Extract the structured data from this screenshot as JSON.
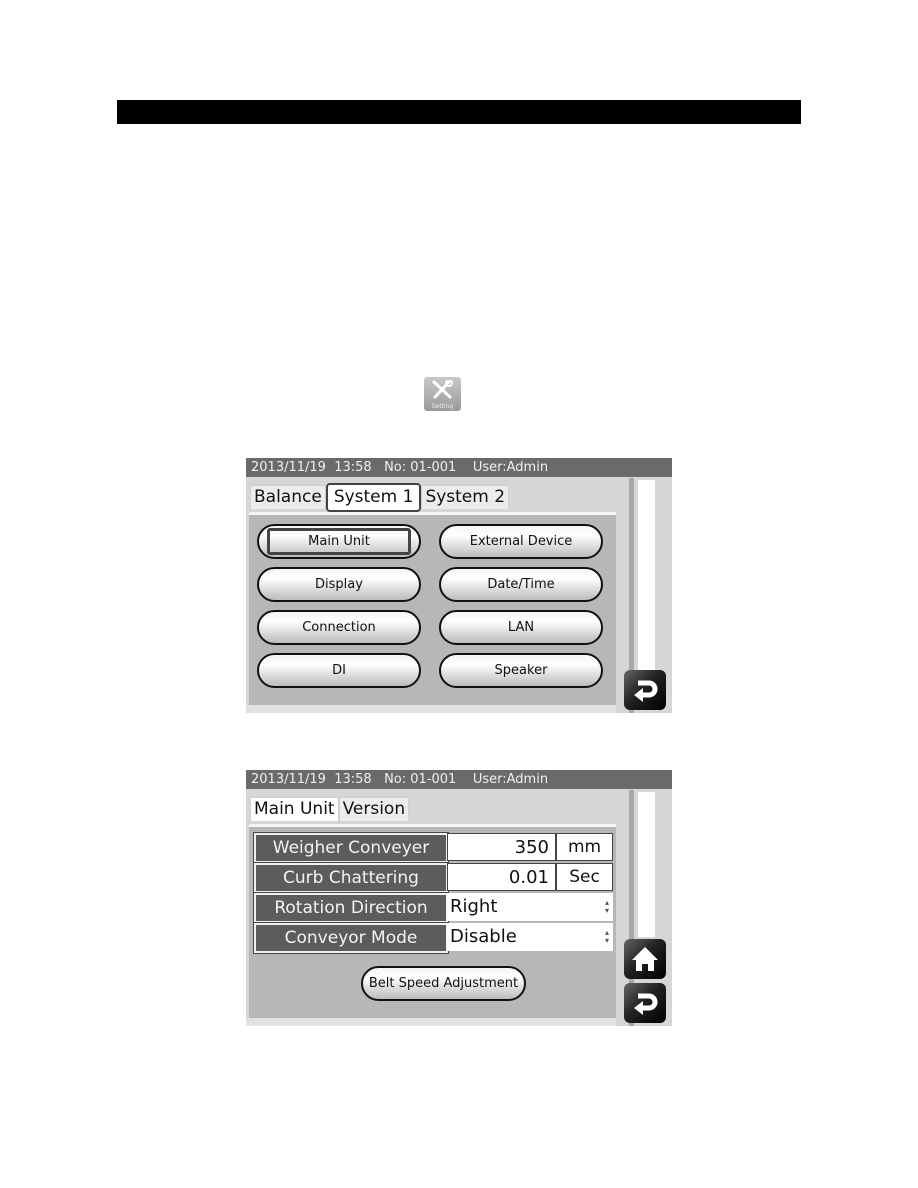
{
  "page": {
    "heading_bar_text": "",
    "inline_icon": {
      "icon": "setting-icon",
      "label": "Setting"
    }
  },
  "screen1": {
    "status": {
      "datetime": "2013/11/19  13:58",
      "number": "No: 01-001",
      "user": "User:Admin"
    },
    "tabs": [
      {
        "label": "Balance",
        "active": false
      },
      {
        "label": "System 1",
        "active": true
      },
      {
        "label": "System 2",
        "active": false
      }
    ],
    "buttons": [
      {
        "label": "Main Unit",
        "selected": true
      },
      {
        "label": "External Device"
      },
      {
        "label": "Display"
      },
      {
        "label": "Date/Time"
      },
      {
        "label": "Connection"
      },
      {
        "label": "LAN"
      },
      {
        "label": "DI"
      },
      {
        "label": "Speaker"
      }
    ],
    "nav": {
      "back_icon": "return-arrow-icon"
    }
  },
  "screen2": {
    "status": {
      "datetime": "2013/11/19  13:58",
      "number": "No: 01-001",
      "user": "User:Admin"
    },
    "tabs": [
      {
        "label": "Main Unit",
        "active": true
      },
      {
        "label": "Version",
        "active": false
      }
    ],
    "fields": [
      {
        "label": "Weigher Conveyer",
        "value": "350",
        "unit": "mm"
      },
      {
        "label": "Curb Chattering",
        "value": "0.01",
        "unit": "Sec"
      },
      {
        "label": "Rotation Direction",
        "selected": "Right"
      },
      {
        "label": "Conveyor Mode",
        "selected": "Disable"
      }
    ],
    "belt_button": "Belt Speed Adjustment",
    "nav": {
      "home_icon": "home-icon",
      "back_icon": "return-arrow-icon"
    }
  },
  "colors": {
    "status_bar": "#6a6a6a",
    "label_cell": "#5c5c5c",
    "panel": "#b7b7b7",
    "screen_bg": "#d6d6d6"
  }
}
